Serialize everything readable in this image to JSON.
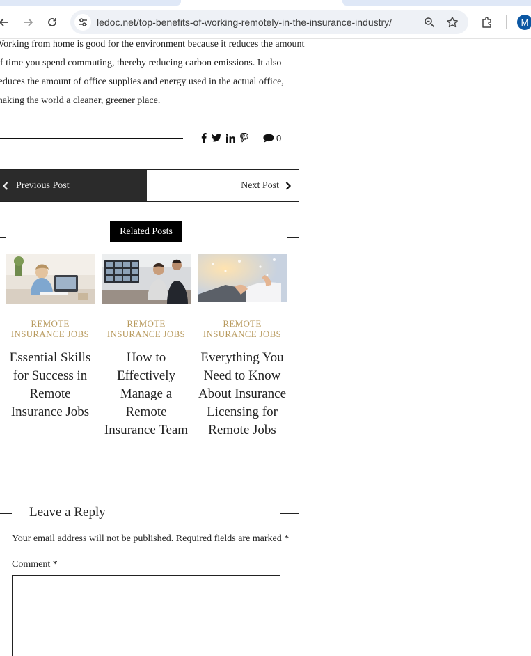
{
  "browser": {
    "url": "ledoc.net/top-benefits-of-working-remotely-in-the-insurance-industry/",
    "profile_initial": "M",
    "accent": "#0b57a3"
  },
  "article": {
    "lines": [
      "Working from home is good for the environment because it reduces the amount",
      "of time you spend commuting, thereby reducing carbon emissions. It also",
      "reduces the amount of office supplies and energy used in the actual office,",
      "making the world a cleaner, greener place."
    ]
  },
  "share": {
    "icons": [
      "facebook-icon",
      "twitter-icon",
      "linkedin-icon",
      "pinterest-icon"
    ],
    "comment_count": "0"
  },
  "post_nav": {
    "previous_label": "Previous Post",
    "next_label": "Next Post"
  },
  "related": {
    "heading": "Related Posts",
    "posts": [
      {
        "category": "REMOTE INSURANCE JOBS",
        "title": "Essential Skills for Success in Remote Insurance Jobs"
      },
      {
        "category": "REMOTE INSURANCE JOBS",
        "title": "How to Effectively Manage a Remote Insurance Team"
      },
      {
        "category": "REMOTE INSURANCE JOBS",
        "title": "Everything You Need to Know About Insurance Licensing for Remote Jobs"
      }
    ],
    "category_color": "#b89a5e"
  },
  "reply": {
    "heading": "Leave a Reply",
    "note": "Your email address will not be published. Required fields are marked *",
    "comment_label": "Comment *"
  }
}
